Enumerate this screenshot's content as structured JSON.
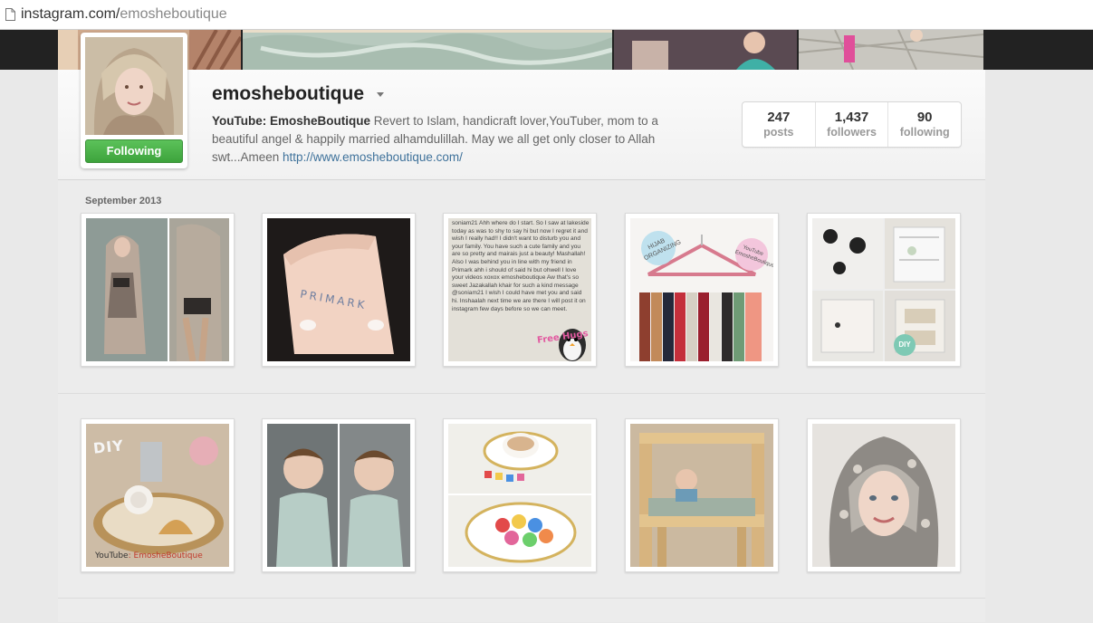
{
  "browser": {
    "url_domain": "instagram.com/",
    "url_path": "emosheboutique"
  },
  "profile": {
    "username": "emosheboutique",
    "follow_button_label": "Following",
    "bio_name": "YouTube: EmosheBoutique",
    "bio_text": "Revert to Islam, handicraft lover,YouTuber, mom to a beautiful angel & happily married alhamdulillah. May we all get only closer to Allah swt...Ameen",
    "bio_link": "http://www.emosheboutique.com/"
  },
  "stats": [
    {
      "value": "247",
      "label": "posts"
    },
    {
      "value": "1,437",
      "label": "followers"
    },
    {
      "value": "90",
      "label": "following"
    }
  ],
  "feed": {
    "month_label": "September 2013",
    "note_text": "soniam21 Ahh where do I start. So I saw at lakeside today as was to shy to say hi but now I regret it and wish I really had!! I didn't want to disturb you and your family. You have such a cute family  and you are so pretty and mairais just a beauty!  Mashallah! Also I was behind you in line with my friend in Primark ahh i should of said hi but ohwell I love your videos xoxox emosheboutique Aw that's so sweet Jazakallah khair for such a kind message @soniam21 I wish I could have met you and said hi. Inshaalah next time we are there I will post it on instagram few days before so we can meet.",
    "free_hugs": "Free Hugs",
    "primark_text": "PRIMARK",
    "hijab_bubble": "HIJAB ORGANIZING",
    "youtube_bubble": "YouTube EmosheBoutique",
    "diy_badge": "DIY",
    "diy_title": "DIY",
    "yt_prefix": "YouTube",
    "yt_suffix": ": EmosheBoutique"
  },
  "colors": {
    "follow_green": "#4cb04a",
    "link_blue": "#3f729b",
    "page_bg": "#e9e9e9"
  }
}
